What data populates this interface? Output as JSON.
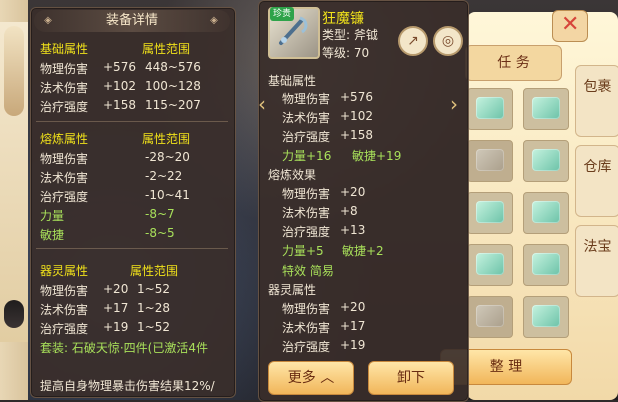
{
  "detail_panel": {
    "title": "装备详情",
    "base": {
      "title_left": "基础属性",
      "title_right": "属性范围",
      "rows": [
        {
          "name": "物理伤害",
          "value": "+576",
          "range": "448~576"
        },
        {
          "name": "法术伤害",
          "value": "+102",
          "range": "100~128"
        },
        {
          "name": "治疗强度",
          "value": "+158",
          "range": "115~207"
        }
      ]
    },
    "smelt": {
      "title_left": "熔炼属性",
      "title_right": "属性范围",
      "rows": [
        {
          "name": "物理伤害",
          "range": "-28~20"
        },
        {
          "name": "法术伤害",
          "range": "-2~22"
        },
        {
          "name": "治疗强度",
          "range": "-10~41"
        },
        {
          "name": "力量",
          "range": "-8~7"
        },
        {
          "name": "敏捷",
          "range": "-8~5"
        }
      ]
    },
    "spirit": {
      "title_left": "器灵属性",
      "title_right": "属性范围",
      "rows": [
        {
          "name": "物理伤害",
          "value": "+20",
          "range": "1~52"
        },
        {
          "name": "法术伤害",
          "value": "+17",
          "range": "1~28"
        },
        {
          "name": "治疗强度",
          "value": "+19",
          "range": "1~52"
        }
      ]
    },
    "set_line": "套装: 石破天惊·四件(已激活4件",
    "effect_line": "提高自身物理暴击伤害结果12%/"
  },
  "item_panel": {
    "badge": "珍贵",
    "name": "狂魔镰",
    "type": "类型: 斧钺",
    "level": "等级: 70",
    "base_title": "基础属性",
    "base_rows": [
      {
        "name": "物理伤害",
        "value": "+576"
      },
      {
        "name": "法术伤害",
        "value": "+102"
      },
      {
        "name": "治疗强度",
        "value": "+158"
      }
    ],
    "base_bonus": [
      "力量+16",
      "敏捷+19"
    ],
    "smelt_title": "熔炼效果",
    "smelt_rows": [
      {
        "name": "物理伤害",
        "value": "+20"
      },
      {
        "name": "法术伤害",
        "value": "+8"
      },
      {
        "name": "治疗强度",
        "value": "+13"
      }
    ],
    "smelt_bonus": [
      "力量+5",
      "敏捷+2"
    ],
    "special": "特效 简易",
    "spirit_title": "器灵属性",
    "spirit_rows": [
      {
        "name": "物理伤害",
        "value": "+20"
      },
      {
        "name": "法术伤害",
        "value": "+17"
      },
      {
        "name": "治疗强度",
        "value": "+19"
      }
    ],
    "btn_more": "更多 ︿",
    "btn_unequip": "卸下"
  },
  "right_ui": {
    "task": "任 务",
    "tabs": [
      "包裹",
      "仓库",
      "法宝"
    ],
    "sort": "整 理"
  },
  "icons": {
    "share": "share-icon",
    "lock": "lock-icon",
    "close": "close-icon",
    "prev": "chevron-left-icon",
    "next": "chevron-right-icon"
  },
  "colors": {
    "accent": "#f0e11a",
    "bonus": "#a8e05a",
    "panel": "#3a2e2a"
  }
}
